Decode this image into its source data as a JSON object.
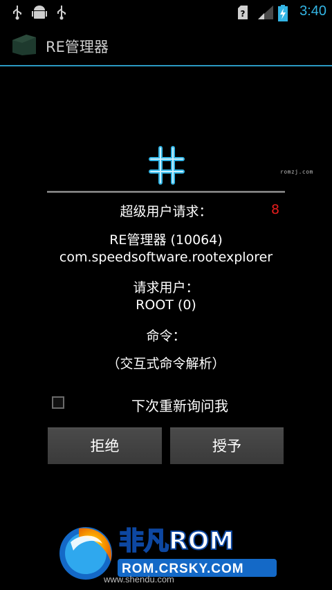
{
  "status_bar": {
    "time": "3:40",
    "icons": [
      "usb-icon",
      "android-debug-icon",
      "usb-icon",
      "sim-unknown-icon",
      "signal-icon",
      "battery-charging-icon"
    ]
  },
  "action_bar": {
    "title": "RE管理器",
    "icon": "re-explorer-app-icon"
  },
  "dialog": {
    "watermark": "romzj.com",
    "heading": "超级用户请求：",
    "countdown": "8",
    "app_name": "RE管理器 (10064)",
    "package": "com.speedsoftware.rootexplorer",
    "requested_user_label": "请求用户：",
    "requested_user": "ROOT (0)",
    "command_label": "命令：",
    "command": "（交互式命令解析）",
    "remember_label": "下次重新询问我",
    "deny_button": "拒绝",
    "allow_button": "授予"
  },
  "branding": {
    "logo_text": "非凡ROM",
    "logo_url": "ROM.CRSKY.COM",
    "site_url": "www.shendu.com"
  },
  "colors": {
    "accent": "#33b5e5",
    "countdown": "#e81d1d",
    "logo_green": "#8fd61c"
  }
}
